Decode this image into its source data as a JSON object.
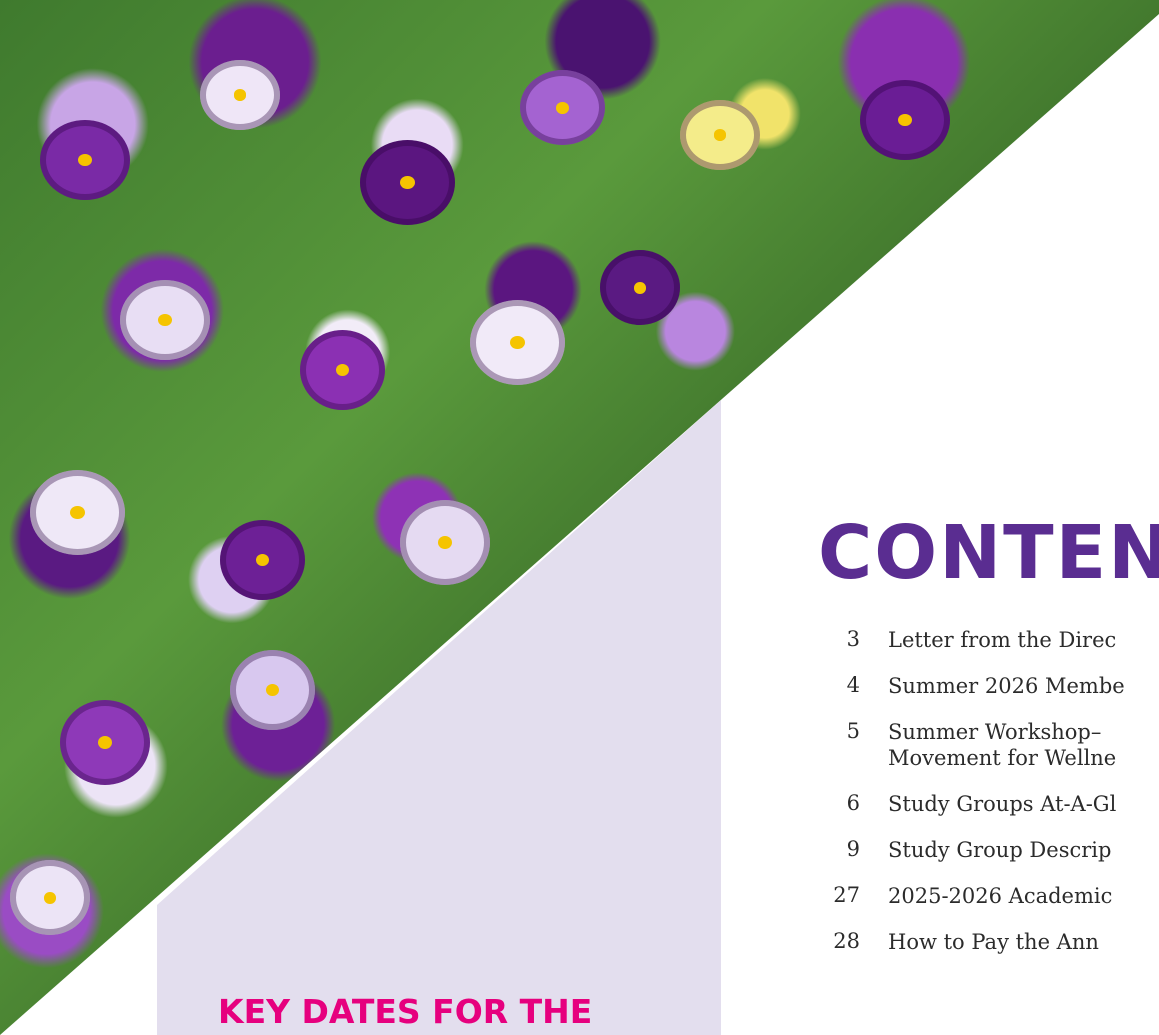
{
  "contents": {
    "title": "CONTEN",
    "items": [
      {
        "page": "3",
        "text": "Letter from the Direc"
      },
      {
        "page": "4",
        "text": "Summer 2026 Membe"
      },
      {
        "page": "5",
        "text": "Summer Workshop–",
        "text2": "Movement for Wellne"
      },
      {
        "page": "6",
        "text": "Study Groups At-A-Gl"
      },
      {
        "page": "9",
        "text": "Study Group Descrip"
      },
      {
        "page": "27",
        "text": "2025-2026 Academic"
      },
      {
        "page": "28",
        "text": "How to Pay the Ann"
      }
    ]
  },
  "key_dates": {
    "heading": "KEY DATES FOR THE"
  },
  "colors": {
    "accent_purple": "#5a2d91",
    "accent_pink": "#e6007e",
    "panel": "#e3deee"
  }
}
